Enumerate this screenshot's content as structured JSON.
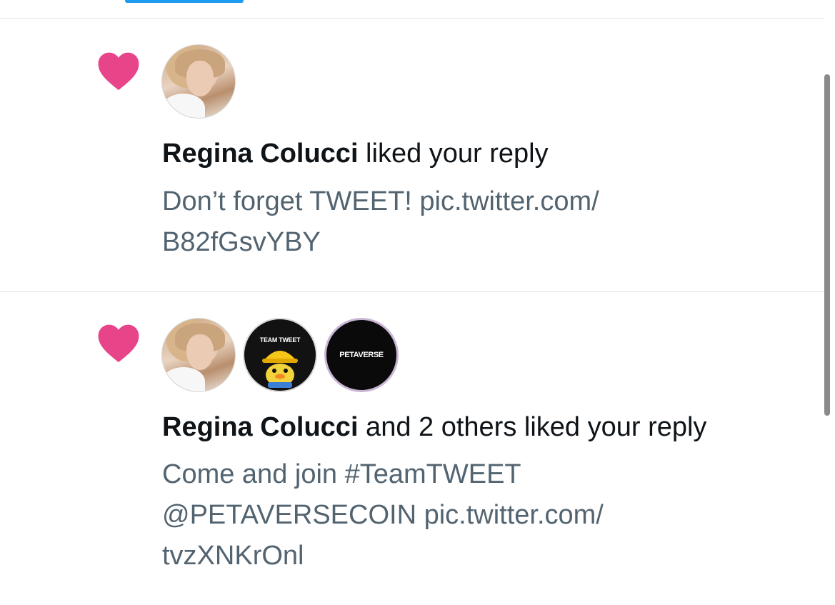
{
  "colors": {
    "heart": "#e8448a",
    "tab_indicator": "#1d9bf0",
    "primary_text": "#0f1419",
    "secondary_text": "#536471"
  },
  "notifications": [
    {
      "icon": "heart-icon",
      "avatars": [
        {
          "name": "regina-colucci-avatar"
        }
      ],
      "actor": "Regina Colucci",
      "action": " liked your reply",
      "text_lines": [
        "Don’t forget TWEET! pic.twitter.com/",
        "B82fGsvYBY"
      ]
    },
    {
      "icon": "heart-icon",
      "avatars": [
        {
          "name": "regina-colucci-avatar"
        },
        {
          "name": "team-tweet-avatar",
          "label": "TEAM TWEET"
        },
        {
          "name": "petaverse-avatar",
          "label": "PETAVERSE"
        }
      ],
      "actor": "Regina Colucci",
      "action": " and 2 others liked your reply",
      "text_lines": [
        "Come and join #TeamTWEET",
        "@PETAVERSECOIN pic.twitter.com/",
        "tvzXNKrOnl"
      ]
    }
  ]
}
